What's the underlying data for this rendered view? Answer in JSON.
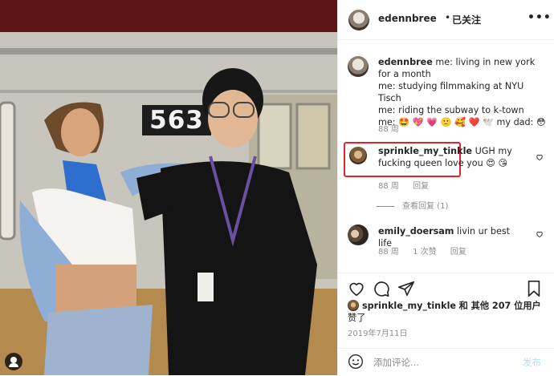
{
  "post": {
    "username": "edennbree",
    "separator": "•",
    "follow_label": "已关注",
    "more_label": "•••"
  },
  "caption": {
    "username": "edennbree",
    "text": "me: living in new york for a month\nme: studying filmmaking at NYU Tisch\nme: riding the subway to k-town\nme: 🤩 💖 💗 🙂 🥰 ❤️ 🕊️  my dad: 😳",
    "time": "88 周"
  },
  "comments": [
    {
      "username": "sprinkle_my_tinkle",
      "text": "UGH my fucking queen love you 😍 😘",
      "time": "88 周",
      "reply_label": "回复",
      "view_replies": "查看回复 (1)",
      "highlighted": true
    },
    {
      "username": "emily_doersam",
      "text": "livin ur best life",
      "time": "88 周",
      "likes_label": "1 次赞",
      "reply_label": "回复"
    }
  ],
  "photo": {
    "train_number": "563"
  },
  "likes": {
    "first_user": "sprinkle_my_tinkle",
    "rest": "和 其他 207 位用户",
    "suffix": "赞了"
  },
  "date": "2019年7月11日",
  "add_comment": {
    "placeholder": "添加评论...",
    "post_label": "发布"
  },
  "colors": {
    "highlight_border": "#e0262b",
    "post_disabled": "#b2dffc",
    "muted_text": "#8e8e8e"
  },
  "icons": [
    "heart-icon",
    "comment-icon",
    "share-icon",
    "bookmark-icon",
    "smiley-icon",
    "user-tag-icon"
  ]
}
